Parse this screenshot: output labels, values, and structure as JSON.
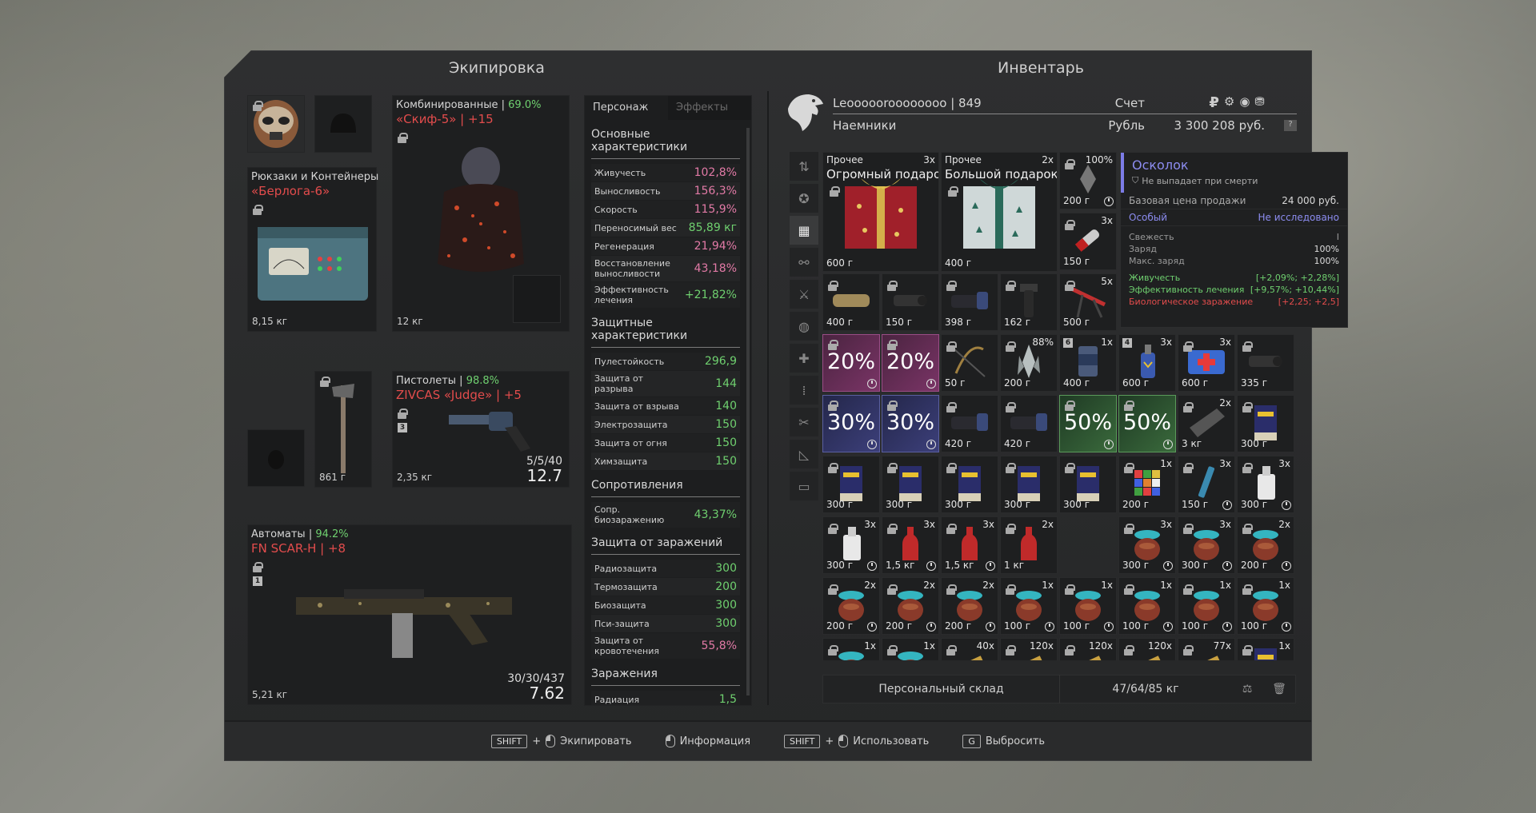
{
  "equipment": {
    "title": "Экипировка",
    "backpack": {
      "label": "Рюкзаки и Контейнеры",
      "name": "«Берлога-6»",
      "weight": "8,15 кг"
    },
    "armor": {
      "label": "Комбинированные | ",
      "pct": "69.0%",
      "name": "«Скиф-5» | +15",
      "weight": "12 кг"
    },
    "melee": {
      "weight": "861 г"
    },
    "pistol": {
      "label": "Пистолеты | ",
      "pct": "98.8%",
      "name": "ZIVCAS «Judge» | +5",
      "ammo": "5/5/40",
      "caliber": "12.7",
      "weight": "2,35 кг",
      "badge": "3"
    },
    "rifle": {
      "label": "Автоматы | ",
      "pct": "94.2%",
      "name": "FN SCAR-H | +8",
      "ammo": "30/30/437",
      "caliber": "7.62",
      "weight": "5,21 кг",
      "badge": "1"
    }
  },
  "stats": {
    "tabs": [
      "Персонаж",
      "Эффекты"
    ],
    "sections": [
      {
        "title": "Основные характеристики",
        "rows": [
          {
            "k": "Живучесть",
            "v": "102,8%",
            "c": "pink"
          },
          {
            "k": "Выносливость",
            "v": "156,3%",
            "c": "pink"
          },
          {
            "k": "Скорость",
            "v": "115,9%",
            "c": "pink"
          },
          {
            "k": "Переносимый вес",
            "v": "85,89 кг",
            "c": "green"
          },
          {
            "k": "Регенерация",
            "v": "21,94%",
            "c": "pink"
          },
          {
            "k": "Восстановление выносливости",
            "v": "43,18%",
            "c": "pink"
          },
          {
            "k": "Эффективность лечения",
            "v": "+21,82%",
            "c": "green"
          }
        ]
      },
      {
        "title": "Защитные характеристики",
        "rows": [
          {
            "k": "Пулестойкость",
            "v": "296,9",
            "c": "green"
          },
          {
            "k": "Защита от разрыва",
            "v": "144",
            "c": "green"
          },
          {
            "k": "Защита от взрыва",
            "v": "140",
            "c": "green"
          },
          {
            "k": "Электрозащита",
            "v": "150",
            "c": "green"
          },
          {
            "k": "Защита от огня",
            "v": "150",
            "c": "green"
          },
          {
            "k": "Химзащита",
            "v": "150",
            "c": "green"
          }
        ]
      },
      {
        "title": "Сопротивления",
        "rows": [
          {
            "k": "Сопр. биозаражению",
            "v": "43,37%",
            "c": "green"
          }
        ]
      },
      {
        "title": "Защита от заражений",
        "rows": [
          {
            "k": "Радиозащита",
            "v": "300",
            "c": "green"
          },
          {
            "k": "Термозащита",
            "v": "200",
            "c": "green"
          },
          {
            "k": "Биозащита",
            "v": "300",
            "c": "green"
          },
          {
            "k": "Пси-защита",
            "v": "300",
            "c": "green"
          },
          {
            "k": "Защита от кровотечения",
            "v": "55,8%",
            "c": "pink"
          }
        ]
      },
      {
        "title": "Заражения",
        "rows": [
          {
            "k": "Радиация",
            "v": "1,5",
            "c": "green"
          }
        ]
      }
    ]
  },
  "inventory": {
    "title": "Инвентарь",
    "nick": "Leoooooroooooooo | 849",
    "faction": "Наемники",
    "account_label": "Счет",
    "currency_label": "Рубль",
    "money": "3 300 208 руб.",
    "ruble_symbol": "₽",
    "help": "?",
    "storage_tab": "Персональный склад",
    "storage_weight": "47/64/85 кг"
  },
  "cells": [
    {
      "col": 0,
      "row": 0,
      "big": true,
      "t": "Прочее",
      "n": "Огромный подарок",
      "q": "3x",
      "w": "600 г",
      "art": "gift-red"
    },
    {
      "col": 2,
      "row": 0,
      "big": true,
      "t": "Прочее",
      "n": "Большой подарок",
      "q": "2x",
      "w": "400 г",
      "art": "gift-white"
    },
    {
      "col": 4,
      "row": 0,
      "q": "100%",
      "w": "200 г",
      "clock": true,
      "art": "shard"
    },
    {
      "col": 4,
      "row": 1,
      "q": "3x",
      "w": "150 г",
      "art": "tube"
    },
    {
      "col": 0,
      "row": 2,
      "w": "400 г",
      "art": "silencer"
    },
    {
      "col": 1,
      "row": 2,
      "w": "150 г",
      "art": "scope-s"
    },
    {
      "col": 2,
      "row": 2,
      "w": "398 г",
      "art": "scope-b"
    },
    {
      "col": 3,
      "row": 2,
      "w": "162 г",
      "art": "grip"
    },
    {
      "col": 4,
      "row": 2,
      "q": "5x",
      "w": "500 г",
      "art": "bipod"
    },
    {
      "col": 0,
      "row": 3,
      "p": "20%",
      "cls": "purple",
      "clock": true
    },
    {
      "col": 1,
      "row": 3,
      "p": "20%",
      "cls": "purple",
      "clock": true
    },
    {
      "col": 2,
      "row": 3,
      "w": "50 г",
      "art": "sling"
    },
    {
      "col": 3,
      "row": 3,
      "q": "88%",
      "w": "200 г",
      "art": "crystal"
    },
    {
      "col": 4,
      "row": 3,
      "q": "1x",
      "w": "400 г",
      "art": "can",
      "badge": "6"
    },
    {
      "col": 5,
      "row": 3,
      "q": "3x",
      "w": "600 г",
      "art": "bottle",
      "badge": "4"
    },
    {
      "col": 6,
      "row": 3,
      "q": "3x",
      "w": "600 г",
      "art": "medkit"
    },
    {
      "col": 7,
      "row": 3,
      "w": "335 г",
      "art": "scope-s"
    },
    {
      "col": 0,
      "row": 4,
      "p": "30%",
      "cls": "blue",
      "clock": true
    },
    {
      "col": 1,
      "row": 4,
      "p": "30%",
      "cls": "blue",
      "clock": true
    },
    {
      "col": 2,
      "row": 4,
      "w": "420 г",
      "art": "scope-b"
    },
    {
      "col": 3,
      "row": 4,
      "w": "420 г",
      "art": "scope-b"
    },
    {
      "col": 4,
      "row": 4,
      "p": "50%",
      "cls": "green-c",
      "clock": true
    },
    {
      "col": 5,
      "row": 4,
      "p": "50%",
      "cls": "green-c",
      "clock": true
    },
    {
      "col": 6,
      "row": 4,
      "q": "2x",
      "w": "3 кг",
      "art": "plate"
    },
    {
      "col": 7,
      "row": 4,
      "w": "300 г",
      "art": "pack"
    },
    {
      "col": 0,
      "row": 5,
      "w": "300 г",
      "art": "pack"
    },
    {
      "col": 1,
      "row": 5,
      "w": "300 г",
      "art": "pack"
    },
    {
      "col": 2,
      "row": 5,
      "w": "300 г",
      "art": "pack"
    },
    {
      "col": 3,
      "row": 5,
      "w": "300 г",
      "art": "pack"
    },
    {
      "col": 4,
      "row": 5,
      "w": "300 г",
      "art": "pack"
    },
    {
      "col": 5,
      "row": 5,
      "q": "1x",
      "w": "200 г",
      "art": "cube"
    },
    {
      "col": 6,
      "row": 5,
      "q": "3x",
      "w": "150 г",
      "clock": true,
      "art": "syringe"
    },
    {
      "col": 7,
      "row": 5,
      "q": "3x",
      "w": "300 г",
      "clock": true,
      "art": "flask"
    },
    {
      "col": 0,
      "row": 6,
      "q": "3x",
      "w": "300 г",
      "clock": true,
      "art": "flask"
    },
    {
      "col": 1,
      "row": 6,
      "q": "3x",
      "w": "1,5 кг",
      "clock": true,
      "art": "redbottle"
    },
    {
      "col": 2,
      "row": 6,
      "q": "3x",
      "w": "1,5 кг",
      "clock": true,
      "art": "redbottle"
    },
    {
      "col": 3,
      "row": 6,
      "q": "2x",
      "w": "1 кг",
      "art": "redbottle"
    },
    {
      "col": 5,
      "row": 6,
      "q": "3x",
      "w": "300 г",
      "clock": true,
      "art": "pot"
    },
    {
      "col": 6,
      "row": 6,
      "q": "3x",
      "w": "300 г",
      "clock": true,
      "art": "pot"
    },
    {
      "col": 7,
      "row": 6,
      "q": "2x",
      "w": "200 г",
      "clock": true,
      "art": "pot"
    },
    {
      "col": 0,
      "row": 7,
      "q": "2x",
      "w": "200 г",
      "clock": true,
      "art": "pot"
    },
    {
      "col": 1,
      "row": 7,
      "q": "2x",
      "w": "200 г",
      "clock": true,
      "art": "pot"
    },
    {
      "col": 2,
      "row": 7,
      "q": "2x",
      "w": "200 г",
      "clock": true,
      "art": "pot"
    },
    {
      "col": 3,
      "row": 7,
      "q": "1x",
      "w": "100 г",
      "clock": true,
      "art": "pot"
    },
    {
      "col": 4,
      "row": 7,
      "q": "1x",
      "w": "100 г",
      "clock": true,
      "art": "pot"
    },
    {
      "col": 5,
      "row": 7,
      "q": "1x",
      "w": "100 г",
      "clock": true,
      "art": "pot"
    },
    {
      "col": 6,
      "row": 7,
      "q": "1x",
      "w": "100 г",
      "clock": true,
      "art": "pot"
    },
    {
      "col": 7,
      "row": 7,
      "q": "1x",
      "w": "100 г",
      "clock": true,
      "art": "pot"
    },
    {
      "col": 0,
      "row": 8,
      "q": "1x",
      "art": "pot"
    },
    {
      "col": 1,
      "row": 8,
      "q": "1x",
      "art": "pot"
    },
    {
      "col": 2,
      "row": 8,
      "q": "40x",
      "art": "ammo"
    },
    {
      "col": 3,
      "row": 8,
      "q": "120x",
      "art": "ammo"
    },
    {
      "col": 4,
      "row": 8,
      "q": "120x",
      "art": "ammo"
    },
    {
      "col": 5,
      "row": 8,
      "q": "120x",
      "art": "ammo"
    },
    {
      "col": 6,
      "row": 8,
      "q": "77x",
      "art": "ammo"
    },
    {
      "col": 7,
      "row": 8,
      "q": "1x",
      "art": "pack"
    }
  ],
  "tooltip": {
    "name": "Осколок",
    "no_drop": "Не выпадает при смерти",
    "base_price_label": "Базовая цена продажи",
    "base_price": "24 000 руб.",
    "rarity": "Особый",
    "research": "Не исследовано",
    "fresh_label": "Свежесть",
    "fresh_val": "I",
    "charge_label": "Заряд",
    "charge_val": "100%",
    "maxcharge_label": "Макс. заряд",
    "maxcharge_val": "100%",
    "eff1_k": "Живучесть",
    "eff1_v": "[+2,09%; +2,28%]",
    "eff2_k": "Эффективность лечения",
    "eff2_v": "[+9,57%; +10,44%]",
    "eff3_k": "Биологическое заражение",
    "eff3_v": "[+2,25; +2,5]"
  },
  "hints": {
    "shift": "SHIFT",
    "plus": "+",
    "equip": "Экипировать",
    "info": "Информация",
    "use": "Использовать",
    "g": "G",
    "drop": "Выбросить"
  }
}
